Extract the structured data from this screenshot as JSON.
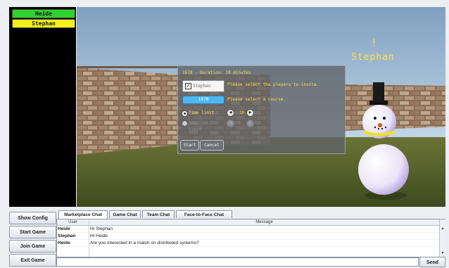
{
  "players": [
    {
      "name": "Heide",
      "color": "#2fd12f"
    },
    {
      "name": "Stephan",
      "color": "#f2ef1a"
    }
  ],
  "scene": {
    "avatar_label": "Stephan",
    "exclamation": "!"
  },
  "invite_dialog": {
    "title": "1678 - Duration: 10 minutes",
    "player_checked": true,
    "player_name": "Stephan",
    "hint_players": "Please select the players to invite.",
    "course_button": "1678",
    "hint_course": "Please select a course.",
    "time_limit_label": "Time limit",
    "time_limit_value": "10",
    "question_limit_label": "Question limit",
    "question_limit_value": "5",
    "start_label": "Start",
    "cancel_label": "Cancel",
    "selected_mode": "Time limit"
  },
  "side_buttons": [
    "Show Config",
    "Start Game",
    "Join Game",
    "Exit Game"
  ],
  "chat": {
    "tabs": [
      "Marketplace Chat",
      "Game Chat",
      "Team Chat",
      "Face-to-Face Chat"
    ],
    "active_tab": "Marketplace Chat",
    "columns": [
      "User",
      "Message"
    ],
    "rows": [
      {
        "user": "Heide",
        "message": "Hi Stephan"
      },
      {
        "user": "Stephan",
        "message": "Hi Heide"
      },
      {
        "user": "Heide",
        "message": "Are you interested in a match on distributed systems?"
      }
    ],
    "input_value": "",
    "send_label": "Send"
  },
  "colors": {
    "hud_text": "#ffe24a",
    "player_green": "#2fd12f",
    "player_yellow": "#f2ef1a",
    "course_button": "#4fb7ef",
    "sky": "#a9c4dd",
    "grass": "#55632a"
  },
  "icons": [
    "checkbox-icon",
    "radio-icon",
    "arrow-left-icon",
    "arrow-right-icon",
    "scroll-up-icon",
    "scroll-down-icon"
  ]
}
